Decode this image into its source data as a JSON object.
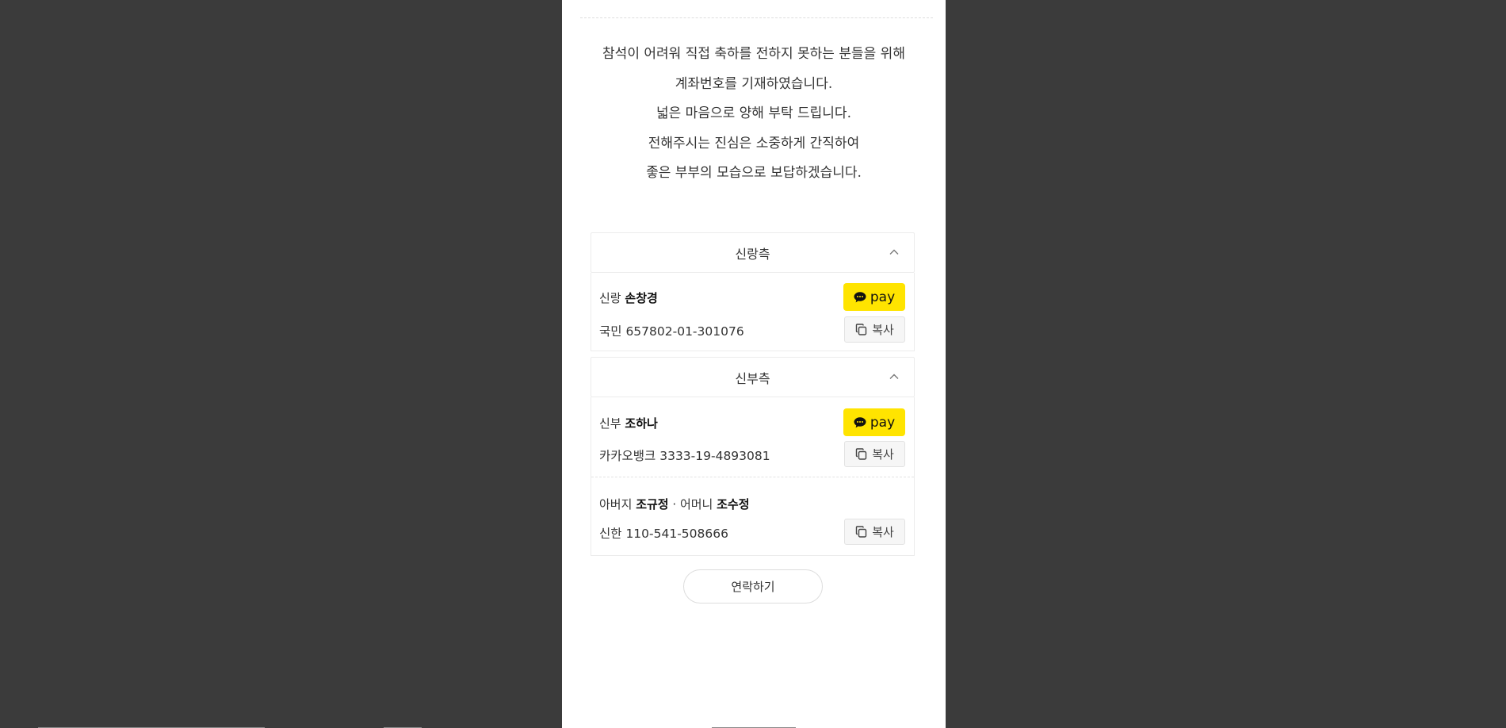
{
  "message": [
    "참석이 어려워 직접 축하를 전하지 못하는 분들을 위해",
    "계좌번호를 기재하였습니다.",
    "넓은 마음으로 양해 부탁 드립니다.",
    "전해주시는 진심은 소중하게 간직하여",
    "좋은 부부의 모습으로 보답하겠습니다."
  ],
  "groom": {
    "header": "신랑측",
    "entries": [
      {
        "role": "신랑",
        "name": "손창경",
        "account": "국민 657802-01-301076",
        "has_pay": true
      }
    ]
  },
  "bride": {
    "header": "신부측",
    "entries": [
      {
        "role": "신부",
        "name": "조하나",
        "account": "카카오뱅크 3333-19-4893081",
        "has_pay": true
      },
      {
        "role": "아버지",
        "name": "조규정",
        "separator": "·",
        "role2": "어머니",
        "name2": "조수정",
        "account": "신한 110-541-508666",
        "has_pay": false
      }
    ]
  },
  "buttons": {
    "pay_label": "pay",
    "copy_label": "복사",
    "contact_label": "연락하기"
  },
  "colors": {
    "background": "#3b3b3b",
    "pay_yellow": "#ffe400"
  },
  "icons": {
    "pay": "kakao-talk-bubble-icon",
    "copy": "copy-icon",
    "collapse": "chevron-up-icon"
  }
}
